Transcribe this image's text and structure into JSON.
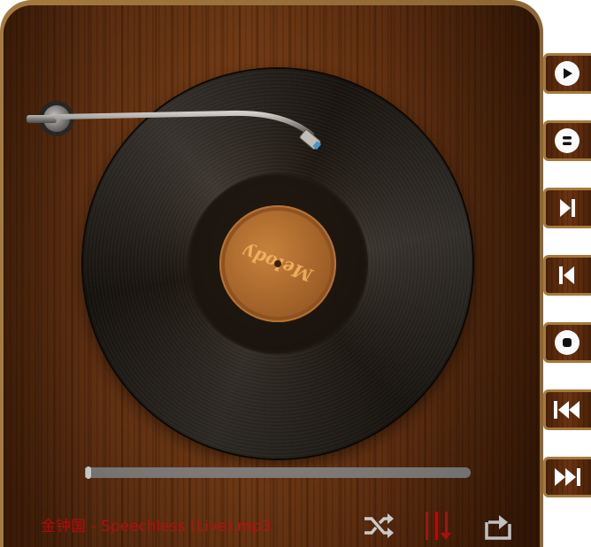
{
  "player": {
    "track_title": "金钟国 - Speechless (Live).mp3",
    "progress": 0.01,
    "record_label_text": "Melody"
  },
  "controls": {
    "shuffle_icon": "shuffle-icon",
    "equalizer_icon": "equalizer-icon",
    "repeat_icon": "repeat-icon"
  },
  "sidebar": {
    "buttons": [
      {
        "icon": "play-icon"
      },
      {
        "icon": "pause-icon"
      },
      {
        "icon": "next-track-icon"
      },
      {
        "icon": "previous-track-icon"
      },
      {
        "icon": "stop-icon"
      },
      {
        "icon": "rewind-icon"
      },
      {
        "icon": "fast-forward-icon"
      }
    ]
  },
  "colors": {
    "title_red": "#e01010",
    "frame_gold": "#a47a3e",
    "wood_dark": "#4a2208"
  }
}
